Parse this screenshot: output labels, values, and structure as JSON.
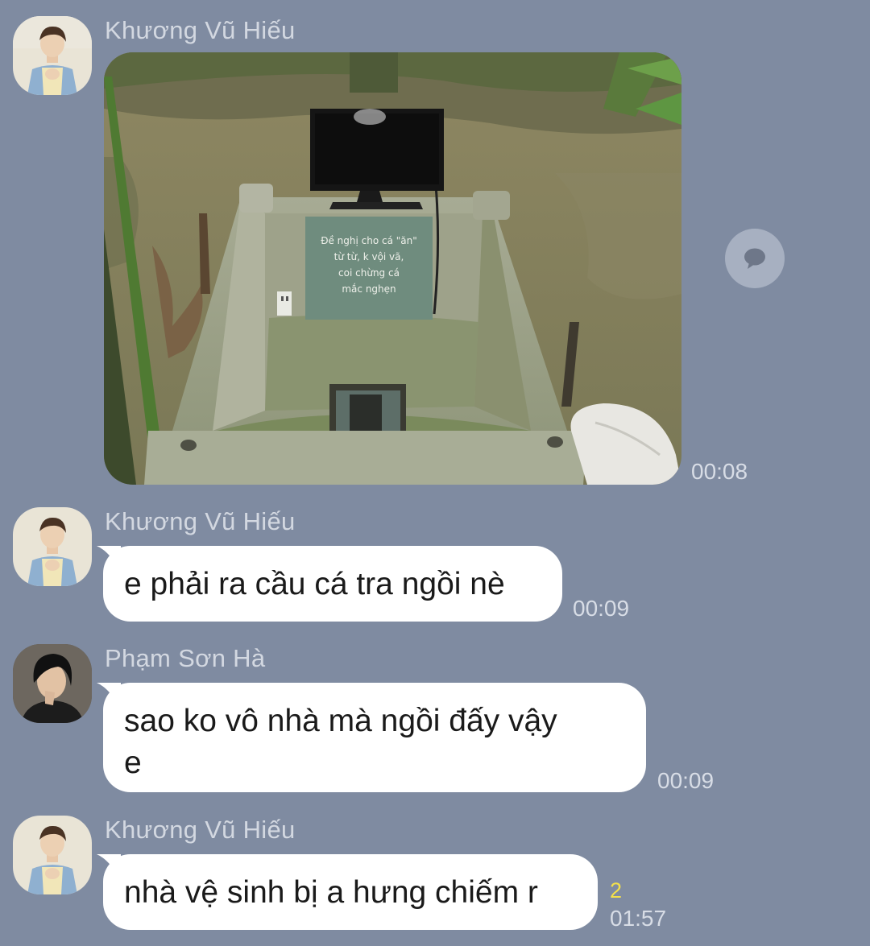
{
  "messages": [
    {
      "sender": "Khương Vũ Hiếu",
      "type": "image",
      "image_sign_text": [
        "Đề nghị cho cá \"ăn\"",
        "từ từ, k vội vã,",
        "coi chừng cá",
        "mắc nghẹn"
      ],
      "time": "00:08"
    },
    {
      "sender": "Khương Vũ Hiếu",
      "type": "text",
      "text": "e phải ra cầu cá tra ngồi nè",
      "time": "00:09"
    },
    {
      "sender": "Phạm Sơn Hà",
      "type": "text",
      "text_line1": "sao ko vô nhà mà ngồi đấy vậy",
      "text_line2": "e",
      "time": "00:09"
    },
    {
      "sender": "Khương Vũ Hiếu",
      "type": "text",
      "text": "nhà vệ sinh bị a hưng chiếm r",
      "read_count": "2",
      "time": "01:57"
    }
  ],
  "icons": {
    "share": "speech-bubble-icon"
  },
  "colors": {
    "background": "#7f8ba1",
    "bubble": "#ffffff",
    "sender_text": "#d3d8e1",
    "time_text": "#d8dde6",
    "read_count": "#f4e04a"
  }
}
